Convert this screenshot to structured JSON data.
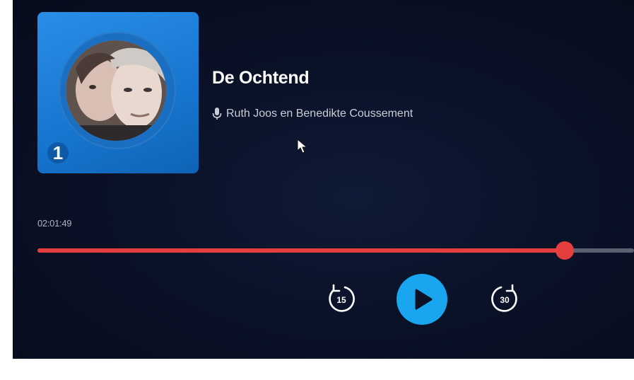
{
  "episode": {
    "title": "De Ochtend",
    "host": "Ruth Joos en Benedikte Coussement",
    "channel_badge": "1"
  },
  "playback": {
    "elapsed": "02:01:49",
    "progress_fraction": 0.884,
    "rewind_seconds": "15",
    "forward_seconds": "30"
  },
  "colors": {
    "progress_accent": "#e53e3e",
    "play_button": "#19a6ee",
    "artwork_blue": "#1676cf",
    "background": "#0a1228"
  },
  "icons": {
    "host": "microphone-icon",
    "rewind": "rewind-15-icon",
    "play": "play-icon",
    "forward": "forward-30-icon",
    "cursor": "mouse-pointer-icon"
  }
}
